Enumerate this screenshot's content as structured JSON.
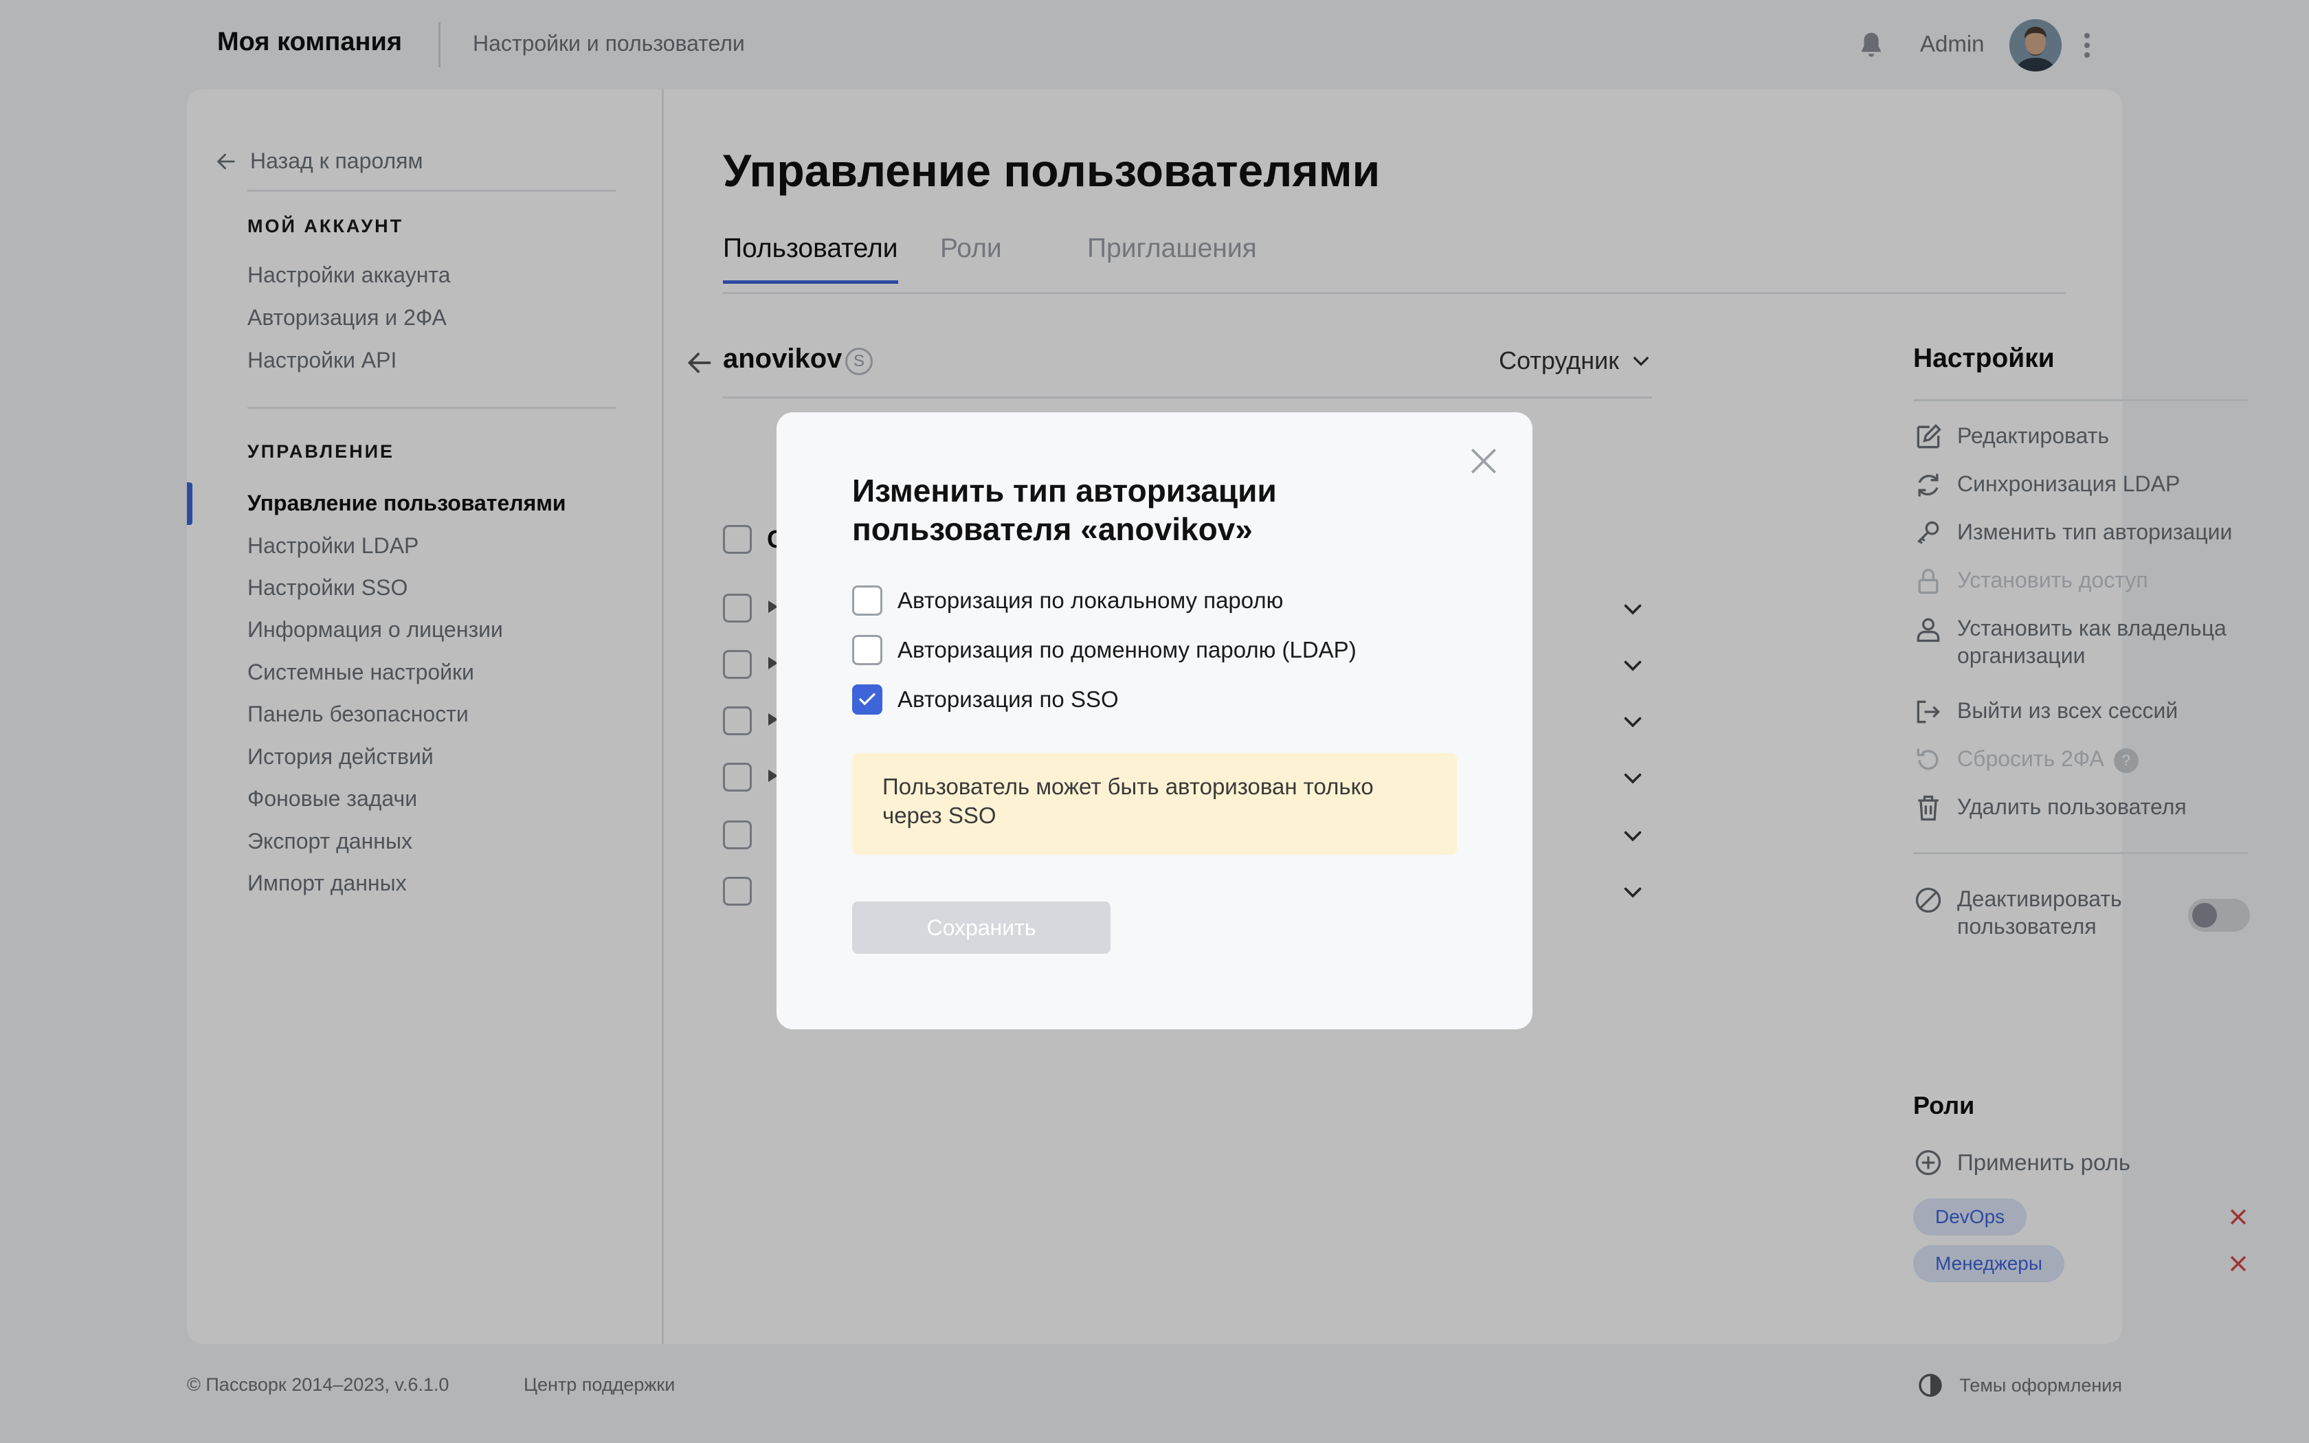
{
  "header": {
    "company": "Моя компания",
    "section": "Настройки и пользователи",
    "user_name": "Admin",
    "icons": [
      "bell-icon",
      "avatar",
      "kebab-menu-icon"
    ]
  },
  "sidebar": {
    "back_label": "Назад к паролям",
    "account_heading": "МОЙ АККАУНТ",
    "account_items": [
      "Настройки аккаунта",
      "Авторизация и 2ФА",
      "Настройки API"
    ],
    "management_heading": "УПРАВЛЕНИЕ",
    "management_items": [
      "Управление пользователями",
      "Настройки LDAP",
      "Настройки SSO",
      "Информация о лицензии",
      "Системные настройки",
      "Панель безопасности",
      "История действий",
      "Фоновые задачи",
      "Экспорт данных",
      "Импорт данных"
    ],
    "active_item": "Управление пользователями"
  },
  "main": {
    "title": "Управление пользователями",
    "tabs": [
      {
        "label": "Пользователи",
        "active": true
      },
      {
        "label": "Роли",
        "active": false
      },
      {
        "label": "Приглашения",
        "active": false
      }
    ],
    "user": {
      "login": "anovikov",
      "badge": "S",
      "role": "Сотрудник"
    },
    "list_first_letter": "С"
  },
  "settings": {
    "title": "Настройки",
    "actions": [
      {
        "label": "Редактировать",
        "icon": "edit-icon",
        "disabled": false
      },
      {
        "label": "Синхронизация LDAP",
        "icon": "sync-icon",
        "disabled": false
      },
      {
        "label": "Изменить тип авторизации",
        "icon": "key-icon",
        "disabled": false
      },
      {
        "label": "Установить доступ",
        "icon": "lock-icon",
        "disabled": true
      },
      {
        "label": "Установить как владельца организации",
        "icon": "user-icon",
        "disabled": false
      },
      {
        "label": "Выйти из всех сессий",
        "icon": "logout-icon",
        "disabled": false
      },
      {
        "label": "Сбросить 2ФА",
        "icon": "reset-icon",
        "disabled": true,
        "help": "?"
      },
      {
        "label": "Удалить пользователя",
        "icon": "trash-icon",
        "disabled": false
      }
    ],
    "deactivate_label": "Деактивировать пользователя",
    "deactivate_on": false,
    "roles_title": "Роли",
    "apply_role_label": "Применить роль",
    "roles": [
      "DevOps",
      "Менеджеры"
    ]
  },
  "footer": {
    "copyright": "© Пассворк 2014–2023, v.6.1.0",
    "support": "Центр поддержки",
    "themes": "Темы оформления"
  },
  "modal": {
    "title": "Изменить тип авторизации пользователя «anovikov»",
    "options": [
      {
        "label": "Авторизация по локальному паролю",
        "checked": false
      },
      {
        "label": "Авторизация по доменному паролю (LDAP)",
        "checked": false
      },
      {
        "label": "Авторизация по SSO",
        "checked": true
      }
    ],
    "notice": "Пользователь может быть авторизован только через SSO",
    "save_label": "Сохранить"
  },
  "colors": {
    "accent": "#3d64d9",
    "notice_bg": "#fdf3d4",
    "danger": "#d64545"
  }
}
